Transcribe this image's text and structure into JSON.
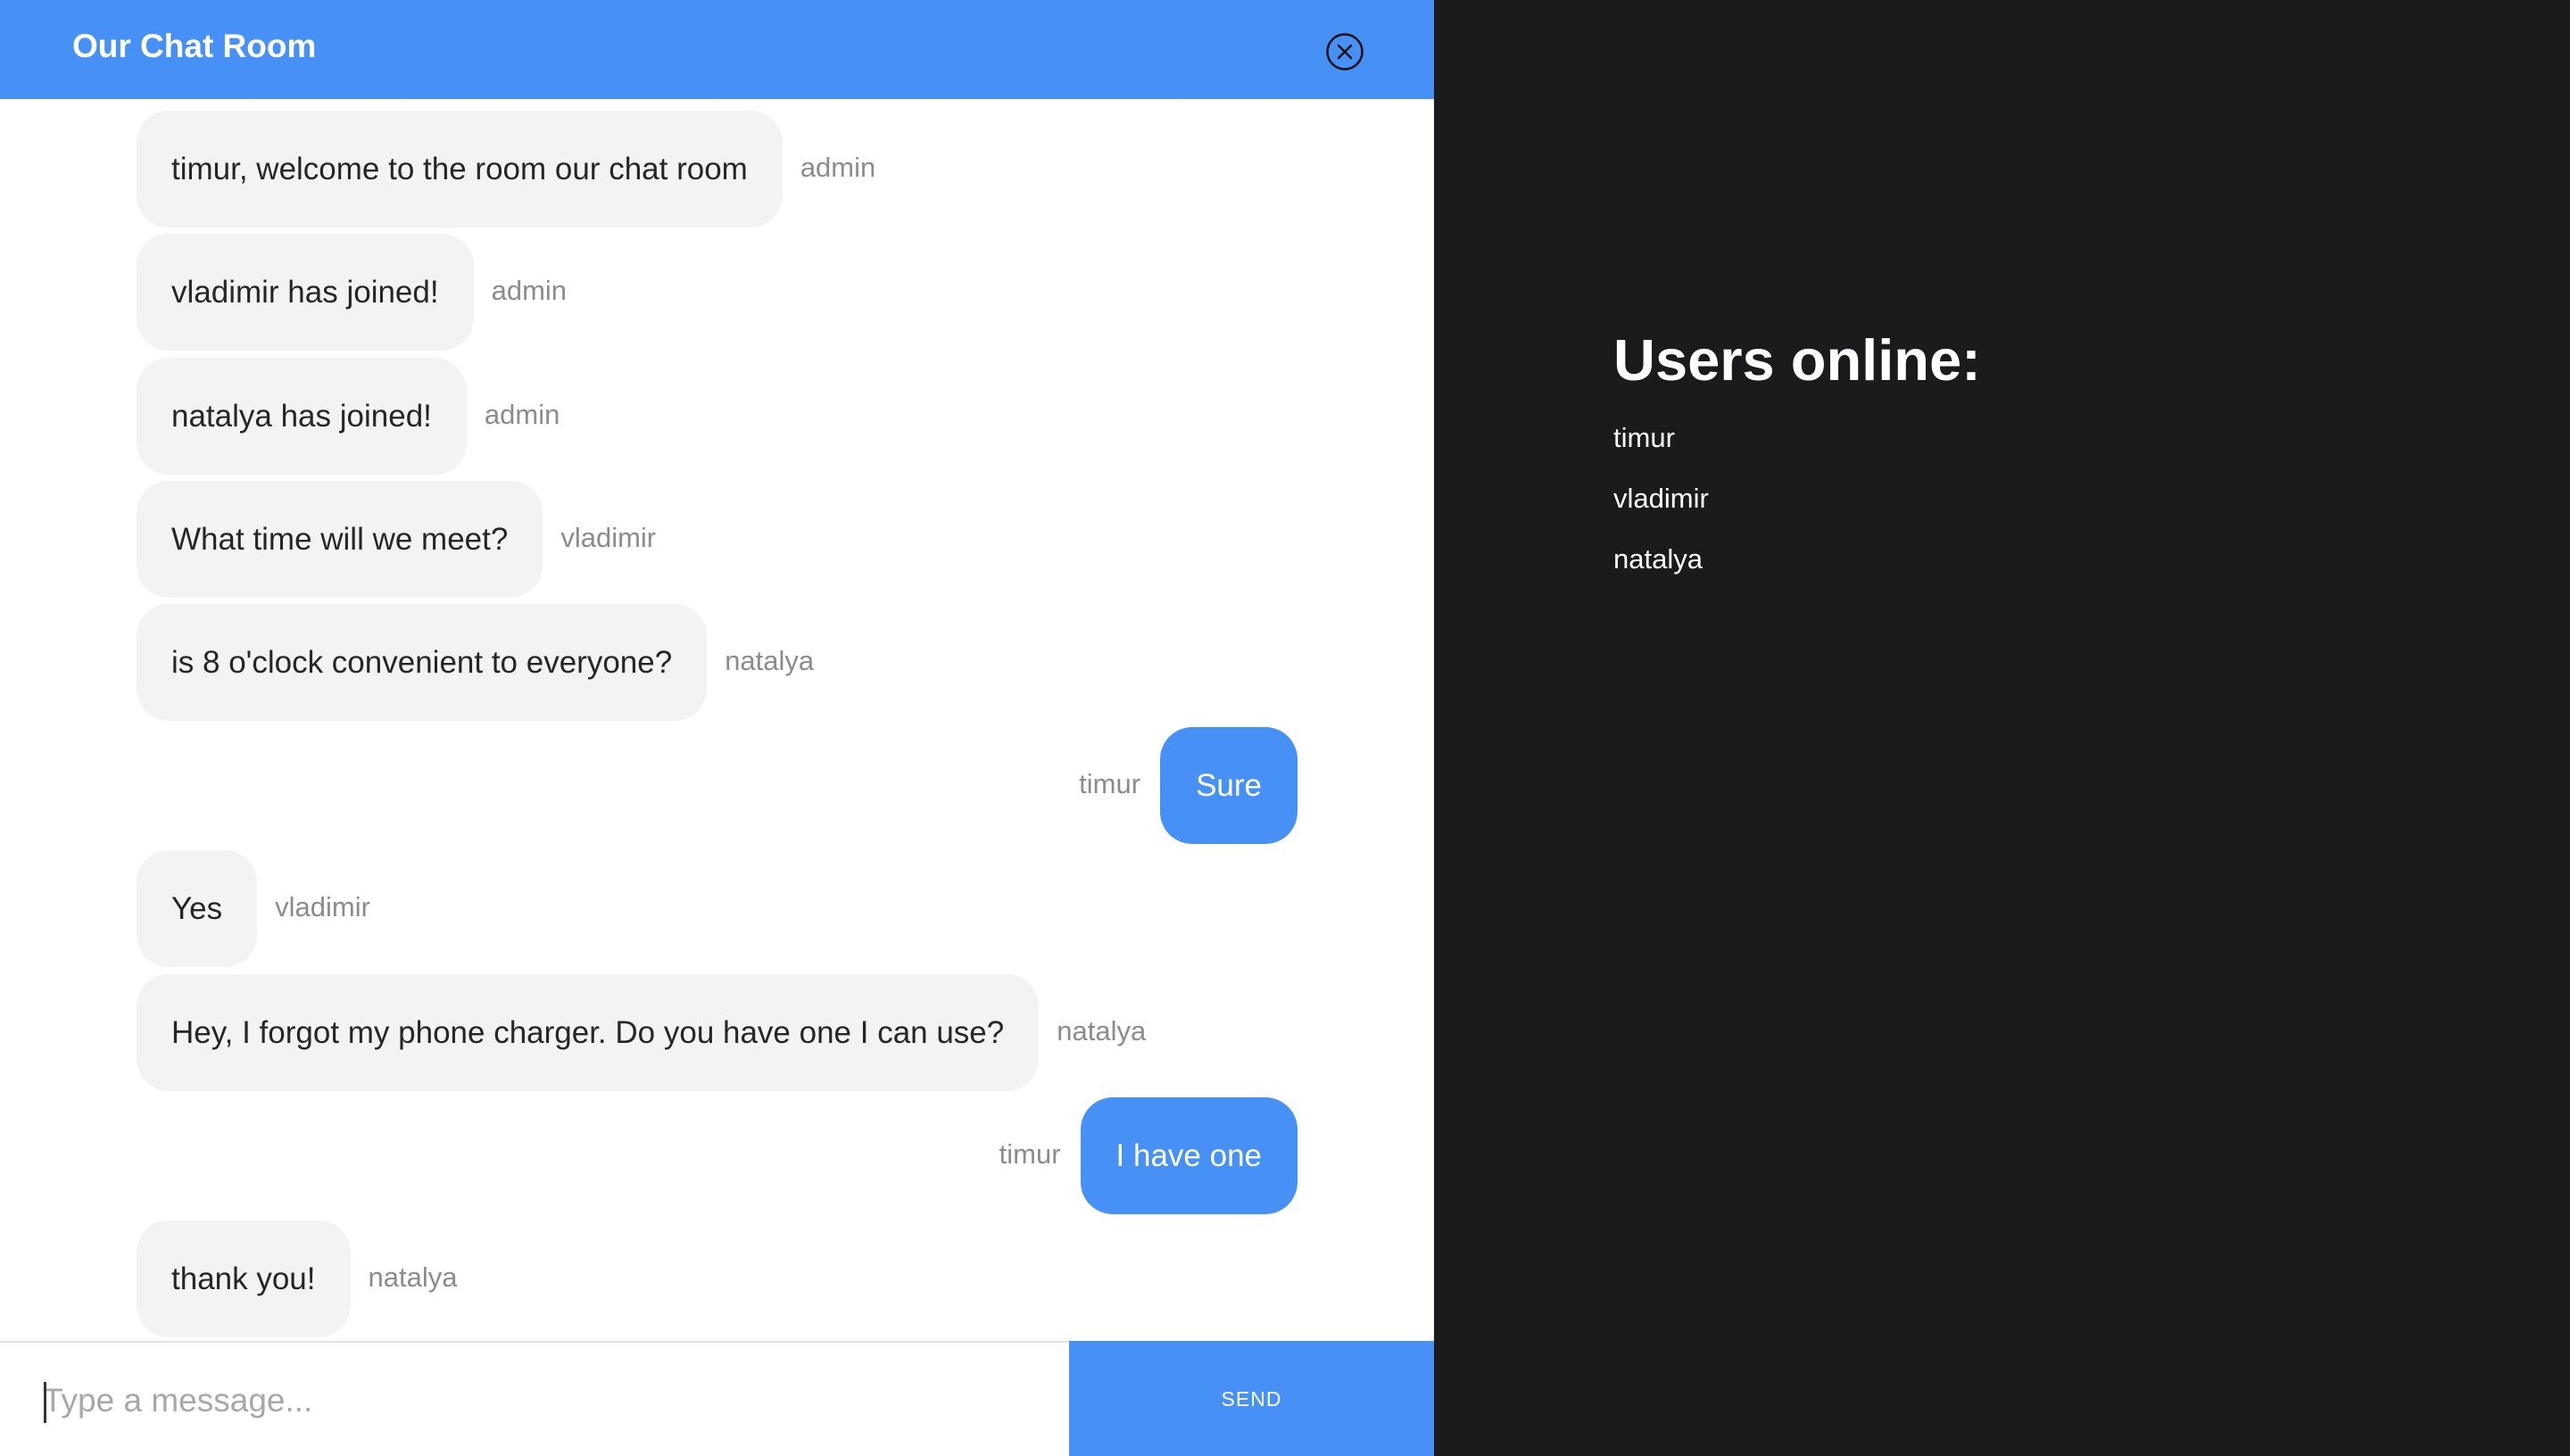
{
  "header": {
    "title": "Our Chat Room",
    "close_icon": "close-circle-icon"
  },
  "messages": [
    {
      "text": "timur, welcome to the room our chat room",
      "sender": "admin",
      "side": "left"
    },
    {
      "text": "vladimir has joined!",
      "sender": "admin",
      "side": "left"
    },
    {
      "text": "natalya has joined!",
      "sender": "admin",
      "side": "left"
    },
    {
      "text": "What time will we meet?",
      "sender": "vladimir",
      "side": "left"
    },
    {
      "text": "is 8 o'clock convenient to everyone?",
      "sender": "natalya",
      "side": "left"
    },
    {
      "text": "Sure",
      "sender": "timur",
      "side": "right"
    },
    {
      "text": "Yes",
      "sender": "vladimir",
      "side": "left"
    },
    {
      "text": "Hey, I forgot my phone charger. Do you have one I can use?",
      "sender": "natalya",
      "side": "left"
    },
    {
      "text": "I have one",
      "sender": "timur",
      "side": "right"
    },
    {
      "text": "thank you!",
      "sender": "natalya",
      "side": "left"
    }
  ],
  "composer": {
    "placeholder": "Type a message...",
    "value": "",
    "send_label": "SEND"
  },
  "users": {
    "title": "Users online:",
    "list": [
      "timur",
      "vladimir",
      "natalya"
    ]
  },
  "colors": {
    "accent": "#4790f5",
    "sidebar_bg": "#1b1b1d",
    "incoming_bubble": "#f3f3f3"
  }
}
